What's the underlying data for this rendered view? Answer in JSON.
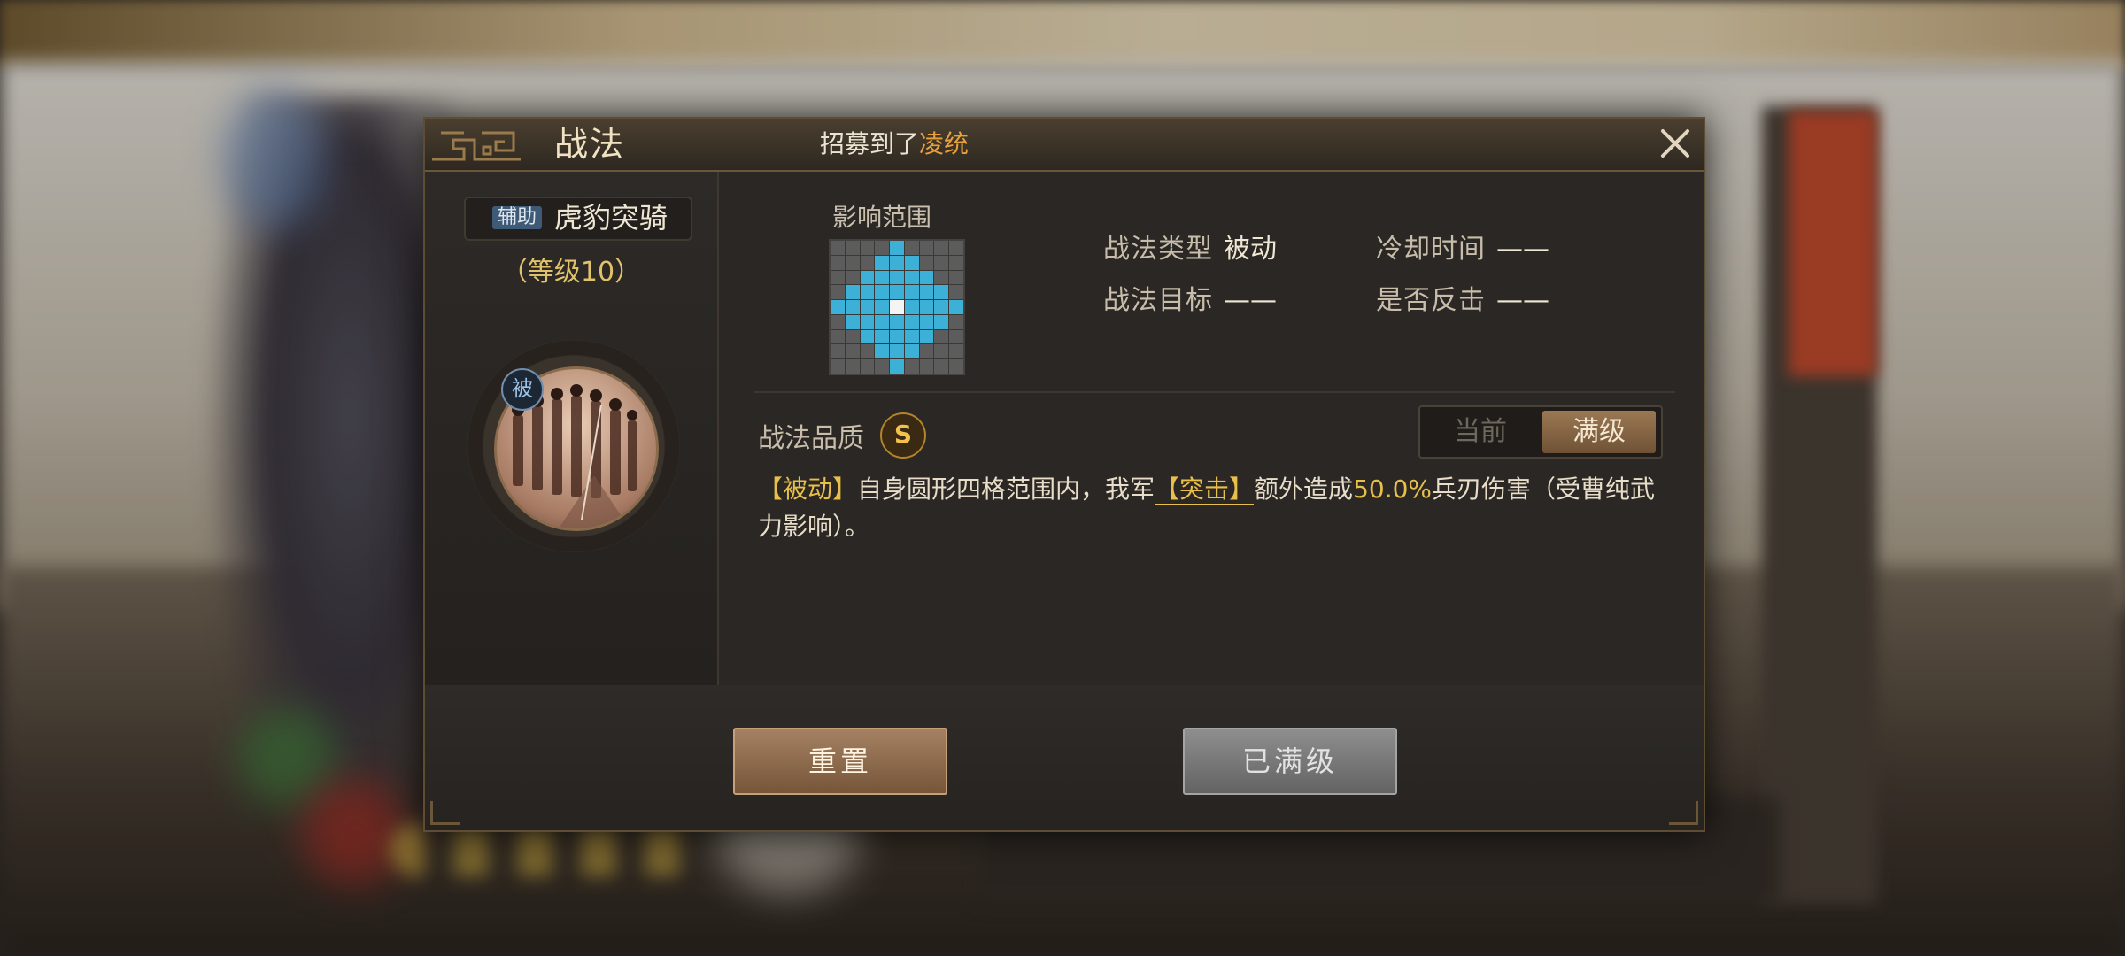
{
  "dialog": {
    "title": "战法",
    "notice_prefix": "招募到了",
    "notice_name": "凌统"
  },
  "skill": {
    "tag": "辅助",
    "name": "虎豹突骑",
    "level": "（等级10）",
    "passive_badge": "被"
  },
  "range": {
    "label": "影响范围"
  },
  "info": {
    "type_key": "战法类型",
    "type_val": "被动",
    "cooldown_key": "冷却时间",
    "cooldown_val": "——",
    "target_key": "战法目标",
    "target_val": "——",
    "counter_key": "是否反击",
    "counter_val": "——"
  },
  "quality": {
    "label": "战法品质",
    "grade": "S"
  },
  "toggle": {
    "current": "当前",
    "max": "满级",
    "selected": "满级"
  },
  "description": {
    "p1": "【被动】",
    "p2": "自身圆形四格范围内，我军",
    "p3": "【突击】",
    "p4": "额外造成",
    "p5": "50.0%",
    "p6": "兵刃伤害（受曹纯武力影响）。"
  },
  "buttons": {
    "reset": "重置",
    "maxed": "已满级"
  },
  "colors": {
    "accent_gold": "#e8bf4a",
    "range_blue": "#3db0d8",
    "highlight_orange": "#e9a13c"
  }
}
